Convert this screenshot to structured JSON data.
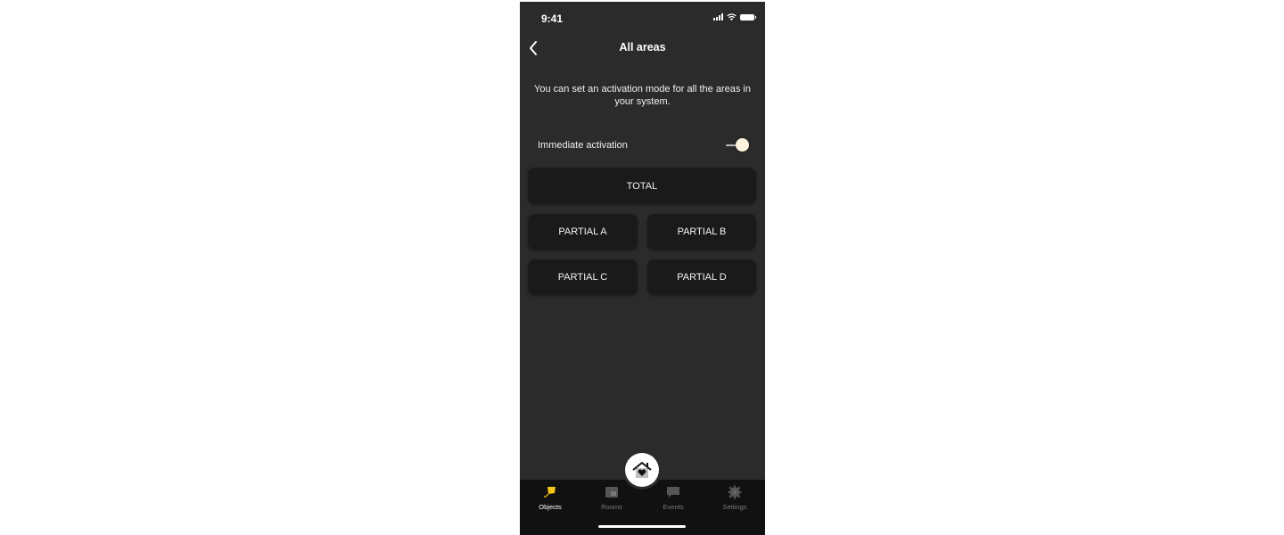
{
  "status_bar": {
    "time": "9:41",
    "icons": [
      "signal-icon",
      "wifi-icon",
      "battery-icon"
    ]
  },
  "nav": {
    "title": "All areas",
    "back_icon": "chevron-left-icon"
  },
  "description": "You can set an activation mode for all the areas in your system.",
  "toggle": {
    "label": "Immediate activation",
    "state": "on"
  },
  "modes": {
    "total": "TOTAL",
    "partial_a": "PARTIAL A",
    "partial_b": "PARTIAL B",
    "partial_c": "PARTIAL C",
    "partial_d": "PARTIAL D"
  },
  "fab": {
    "icon": "home-heart-icon"
  },
  "tabs": [
    {
      "label": "Objects",
      "icon": "objects-icon",
      "active": true
    },
    {
      "label": "Rooms",
      "icon": "rooms-icon",
      "active": false
    },
    {
      "label": "Events",
      "icon": "chat-bubble-icon",
      "active": false
    },
    {
      "label": "Settings",
      "icon": "gear-icon",
      "active": false
    }
  ],
  "colors": {
    "background": "#2b2b2b",
    "button": "#1a1a1a",
    "tab_bar": "#111111",
    "accent_yellow": "#f5c518",
    "inactive": "#7a7a7a"
  }
}
